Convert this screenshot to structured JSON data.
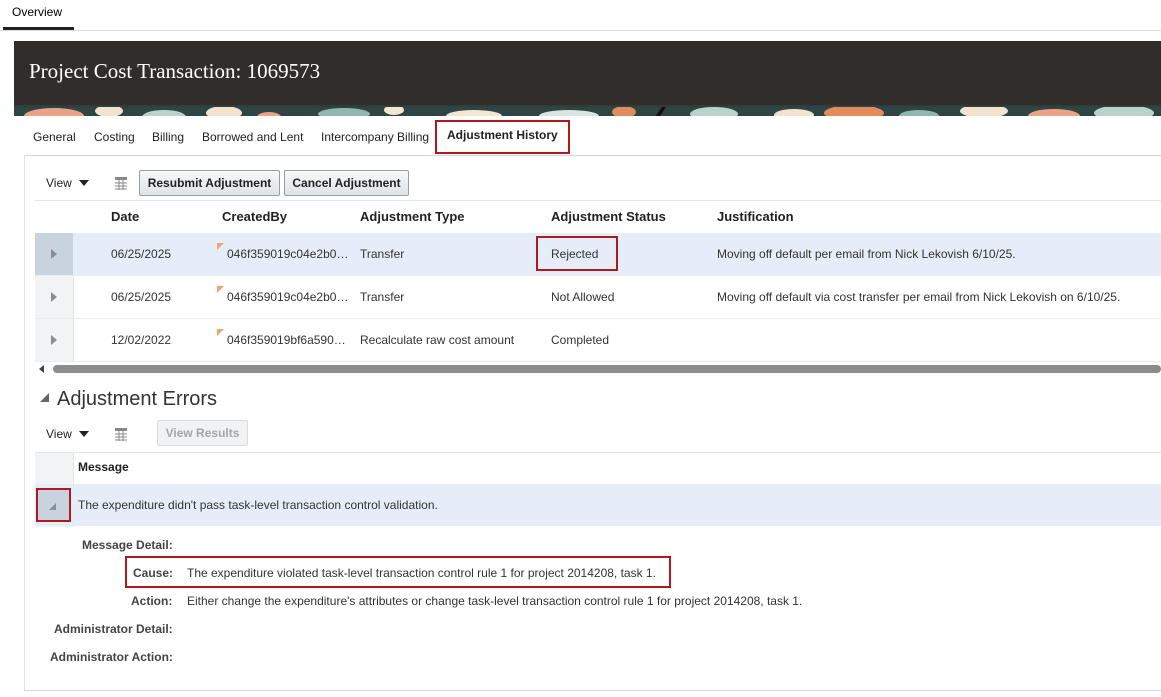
{
  "top_tabs": {
    "overview": "Overview"
  },
  "header": {
    "title": "Project Cost Transaction: 1069573"
  },
  "subtabs": [
    {
      "label": "General"
    },
    {
      "label": "Costing"
    },
    {
      "label": "Billing"
    },
    {
      "label": "Borrowed and Lent"
    },
    {
      "label": "Intercompany Billing"
    },
    {
      "label": "Adjustment History",
      "active": true
    }
  ],
  "history_toolbar": {
    "view_label": "View",
    "resubmit_label": "Resubmit Adjustment",
    "cancel_label": "Cancel Adjustment",
    "freeze_icon": "freeze-columns-icon"
  },
  "history_table": {
    "columns": [
      "Date",
      "CreatedBy",
      "Adjustment Type",
      "Adjustment Status",
      "Justification"
    ],
    "rows": [
      {
        "date": "06/25/2025",
        "created_by": "046f359019c04e2b0…",
        "type": "Transfer",
        "status": "Rejected",
        "justification": "Moving off default per email from Nick Lekovish 6/10/25."
      },
      {
        "date": "06/25/2025",
        "created_by": "046f359019c04e2b0…",
        "type": "Transfer",
        "status": "Not Allowed",
        "justification": "Moving off default via cost transfer per email from Nick Lekovish on 6/10/25."
      },
      {
        "date": "12/02/2022",
        "created_by": "046f359019bf6a590…",
        "type": "Recalculate raw cost amount",
        "status": "Completed",
        "justification": ""
      }
    ]
  },
  "errors_section": {
    "title": "Adjustment Errors",
    "view_label": "View",
    "view_results_label": "View Results",
    "message_header": "Message",
    "message": "The expenditure didn't pass task-level transaction control validation.",
    "detail": {
      "message_detail_label": "Message Detail:",
      "cause_label": "Cause:",
      "cause_value": "The expenditure violated task-level transaction control rule 1 for project 2014208, task 1.",
      "action_label": "Action:",
      "action_value": "Either change the expenditure's attributes or change task-level transaction control rule 1 for project 2014208, task 1.",
      "admin_detail_label": "Administrator Detail:",
      "admin_action_label": "Administrator Action:"
    }
  },
  "colors": {
    "header_bg": "#312d2a",
    "highlight": "#b0181d",
    "selected_row": "#e5eef8"
  }
}
